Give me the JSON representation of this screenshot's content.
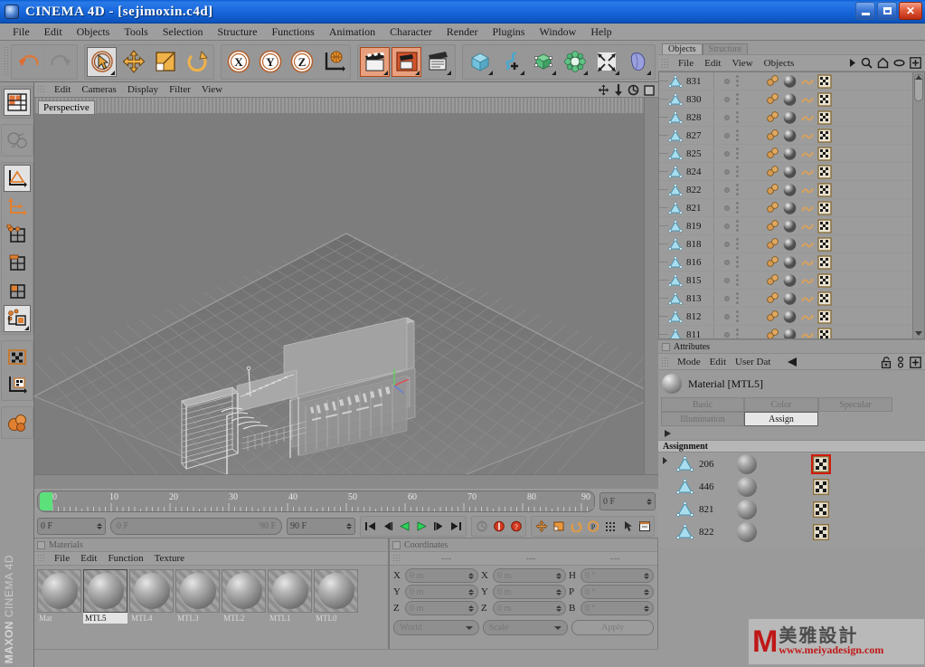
{
  "window": {
    "title": "CINEMA 4D - [sejimoxin.c4d]",
    "app_icon": "c4d-app-icon",
    "minimize_label": "_",
    "maximize_label": "□",
    "close_label": "✕"
  },
  "menubar": {
    "items": [
      {
        "label": "File"
      },
      {
        "label": "Edit"
      },
      {
        "label": "Objects"
      },
      {
        "label": "Tools"
      },
      {
        "label": "Selection"
      },
      {
        "label": "Structure"
      },
      {
        "label": "Functions"
      },
      {
        "label": "Animation"
      },
      {
        "label": "Character"
      },
      {
        "label": "Render"
      },
      {
        "label": "Plugins"
      },
      {
        "label": "Window"
      },
      {
        "label": "Help"
      }
    ]
  },
  "toolbar": {
    "groups": [
      {
        "name": "history",
        "buttons": [
          {
            "icon": "undo-icon",
            "state": "normal"
          },
          {
            "icon": "redo-icon",
            "state": "disabled"
          }
        ]
      },
      {
        "name": "transform",
        "buttons": [
          {
            "icon": "live-selection-icon",
            "state": "active"
          },
          {
            "icon": "move-icon",
            "state": "normal"
          },
          {
            "icon": "scale-icon",
            "state": "normal"
          },
          {
            "icon": "rotate-icon",
            "state": "normal"
          }
        ]
      },
      {
        "name": "axis-lock",
        "buttons": [
          {
            "icon": "lock-x-axis-icon",
            "state": "normal"
          },
          {
            "icon": "lock-y-axis-icon",
            "state": "normal"
          },
          {
            "icon": "lock-z-axis-icon",
            "state": "normal"
          },
          {
            "icon": "world-coordinate-icon",
            "state": "normal"
          }
        ]
      },
      {
        "name": "render",
        "buttons": [
          {
            "icon": "render-view-icon",
            "state": "hot"
          },
          {
            "icon": "render-region-icon",
            "state": "hot"
          },
          {
            "icon": "render-settings-icon",
            "state": "normal"
          }
        ]
      },
      {
        "name": "create",
        "buttons": [
          {
            "icon": "cube-primitive-icon",
            "state": "normal"
          },
          {
            "icon": "spline-pen-icon",
            "state": "normal"
          },
          {
            "icon": "nurbs-icon",
            "state": "normal"
          },
          {
            "icon": "array-modeling-icon",
            "state": "normal"
          },
          {
            "icon": "deformer-icon",
            "state": "normal"
          },
          {
            "icon": "scene-object-icon",
            "state": "normal"
          }
        ]
      }
    ]
  },
  "left_toolbar": {
    "groups": [
      {
        "buttons": [
          {
            "icon": "layout-manager-icon",
            "state": "normal"
          }
        ]
      },
      {
        "buttons": [
          {
            "icon": "make-editable-icon",
            "state": "disabled"
          }
        ]
      },
      {
        "buttons": [
          {
            "icon": "model-mode-icon",
            "state": "active"
          },
          {
            "icon": "object-axis-mode-icon",
            "state": "normal"
          },
          {
            "icon": "point-mode-icon",
            "state": "normal"
          },
          {
            "icon": "edge-mode-icon",
            "state": "normal"
          },
          {
            "icon": "polygon-mode-icon",
            "state": "normal"
          },
          {
            "icon": "animation-mode-icon",
            "state": "active"
          }
        ]
      },
      {
        "buttons": [
          {
            "icon": "texture-mode-icon",
            "state": "normal"
          },
          {
            "icon": "texture-axis-mode-icon",
            "state": "normal"
          }
        ]
      },
      {
        "buttons": [
          {
            "icon": "deformation-enable-icon",
            "state": "normal"
          }
        ]
      }
    ],
    "brand_line1": "MAXON",
    "brand_line2": "CINEMA 4D"
  },
  "viewport": {
    "menu": [
      {
        "label": "Edit"
      },
      {
        "label": "Cameras"
      },
      {
        "label": "Display"
      },
      {
        "label": "Filter"
      },
      {
        "label": "View"
      }
    ],
    "view_label": "Perspective",
    "corner_icons": [
      {
        "icon": "pan-view-icon"
      },
      {
        "icon": "dolly-view-icon"
      },
      {
        "icon": "rotate-view-icon"
      },
      {
        "icon": "maximize-view-icon"
      }
    ],
    "axis_labels": {
      "x": "X",
      "y": "Y",
      "z": "Z"
    }
  },
  "timeline": {
    "ticks": [
      "0",
      "10",
      "20",
      "30",
      "40",
      "50",
      "60",
      "70",
      "80",
      "90"
    ],
    "playhead_frame": "0",
    "current_frame_field": "0 F"
  },
  "transport": {
    "current_frame": "0 F",
    "range_start": "0 F",
    "range_end": "90 F",
    "max_frame": "90 F",
    "buttons": [
      {
        "icon": "go-to-start-icon"
      },
      {
        "icon": "step-back-icon"
      },
      {
        "icon": "play-reverse-icon"
      },
      {
        "icon": "play-forward-icon"
      },
      {
        "icon": "step-forward-icon"
      },
      {
        "icon": "go-to-end-icon"
      }
    ],
    "record_buttons": [
      {
        "icon": "autokeying-icon"
      },
      {
        "icon": "record-active-objects-icon"
      },
      {
        "icon": "record-question-icon"
      }
    ],
    "key_buttons": [
      {
        "icon": "key-position-icon"
      },
      {
        "icon": "key-scale-icon"
      },
      {
        "icon": "key-rotation-icon"
      },
      {
        "icon": "key-parameter-icon"
      },
      {
        "icon": "key-pla-icon"
      },
      {
        "icon": "key-selection-icon"
      },
      {
        "icon": "timeline-window-icon"
      }
    ]
  },
  "materials_panel": {
    "title": "Materials",
    "menu": [
      {
        "label": "File"
      },
      {
        "label": "Edit"
      },
      {
        "label": "Function"
      },
      {
        "label": "Texture"
      }
    ],
    "items": [
      {
        "name": "Mat",
        "selected": false
      },
      {
        "name": "MTL5",
        "selected": true
      },
      {
        "name": "MTL4",
        "selected": false
      },
      {
        "name": "MTL3",
        "selected": false
      },
      {
        "name": "MTL2",
        "selected": false
      },
      {
        "name": "MTL1",
        "selected": false
      },
      {
        "name": "MTL0",
        "selected": false
      }
    ]
  },
  "coordinates_panel": {
    "title": "Coordinates",
    "header_dashes": [
      "---",
      "---",
      "---"
    ],
    "rows": [
      {
        "pos_label": "X",
        "pos_value": "0 m",
        "size_label": "X",
        "size_value": "0 m",
        "rot_label": "H",
        "rot_value": "0 °"
      },
      {
        "pos_label": "Y",
        "pos_value": "0 m",
        "size_label": "Y",
        "size_value": "0 m",
        "rot_label": "P",
        "rot_value": "0 °"
      },
      {
        "pos_label": "Z",
        "pos_value": "0 m",
        "size_label": "Z",
        "size_value": "0 m",
        "rot_label": "B",
        "rot_value": "0 °"
      }
    ],
    "coord_system": "World",
    "transform_mode": "Scale",
    "apply_label": "Apply"
  },
  "object_manager": {
    "tabs": [
      {
        "label": "Objects",
        "active": true
      },
      {
        "label": "Structure",
        "active": false
      }
    ],
    "menu": [
      {
        "label": "File"
      },
      {
        "label": "Edit"
      },
      {
        "label": "View"
      },
      {
        "label": "Objects"
      }
    ],
    "header_icons": [
      {
        "icon": "chevron-right-icon"
      },
      {
        "icon": "search-icon"
      },
      {
        "icon": "home-icon"
      },
      {
        "icon": "ellipse-icon"
      },
      {
        "icon": "add-icon"
      }
    ],
    "objects": [
      {
        "name": "831"
      },
      {
        "name": "830"
      },
      {
        "name": "828"
      },
      {
        "name": "827"
      },
      {
        "name": "825"
      },
      {
        "name": "824"
      },
      {
        "name": "822"
      },
      {
        "name": "821"
      },
      {
        "name": "819"
      },
      {
        "name": "818"
      },
      {
        "name": "816"
      },
      {
        "name": "815"
      },
      {
        "name": "813"
      },
      {
        "name": "812"
      },
      {
        "name": "811"
      }
    ],
    "row_icons": [
      "polygon-object-icon",
      "phong-tag-icon",
      "material-tag-icon",
      "uvw-tag-icon",
      "texture-tag-icon"
    ]
  },
  "attributes_panel": {
    "title": "Attributes",
    "menu": [
      {
        "label": "Mode"
      },
      {
        "label": "Edit"
      },
      {
        "label": "User Dat"
      }
    ],
    "back_icon": "back-arrow-icon",
    "header_icons": [
      {
        "icon": "lock-icon"
      },
      {
        "icon": "pin-icon"
      },
      {
        "icon": "add-icon"
      }
    ],
    "object_title": "Material [MTL5]",
    "object_icon": "material-sphere-icon",
    "tabs_row1": [
      {
        "label": "Basic",
        "active": false
      },
      {
        "label": "Color",
        "active": false
      },
      {
        "label": "Specular",
        "active": false
      }
    ],
    "tabs_row2": [
      {
        "label": "Illumination",
        "active": false
      },
      {
        "label": "Assign",
        "active": true
      }
    ],
    "section_label": "Assignment",
    "assignments": [
      {
        "name": "206",
        "selected": true
      },
      {
        "name": "446",
        "selected": false
      },
      {
        "name": "821",
        "selected": false
      },
      {
        "name": "822",
        "selected": false
      }
    ]
  },
  "watermark": {
    "logo_letter": "M",
    "chinese_text": "美雅設計",
    "url": "www.meiyadesign.com"
  },
  "colors": {
    "titlebar_blue": "#1767dc",
    "panel_gray": "#9a9a9a",
    "accent_orange": "#e89a3c",
    "selection_red": "#d01a0d",
    "playhead_green": "#5ce07a",
    "viewport_gray": "#7d7d7d"
  }
}
